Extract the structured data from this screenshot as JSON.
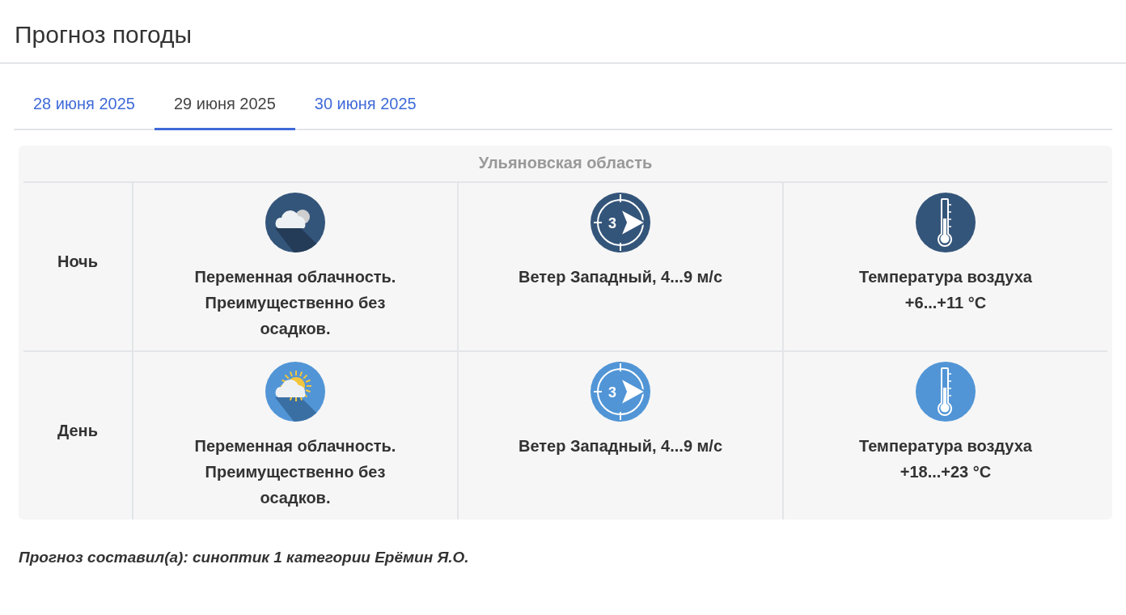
{
  "title": "Прогноз погоды",
  "tabs": [
    {
      "label": "28 июня 2025",
      "selected": false
    },
    {
      "label": "29 июня 2025",
      "selected": true
    },
    {
      "label": "30 июня 2025",
      "selected": false
    }
  ],
  "region": "Ульяновская область",
  "rows": [
    {
      "kind": "night",
      "period": "Ночь",
      "sky": "Переменная облачность. Преимущественно без осадков.",
      "wind_icon_label": "3",
      "wind": "Ветер Западный, 4...9 м/с",
      "temperature_label": "Температура воздуха",
      "temperature": "+6...+11 °С"
    },
    {
      "kind": "day",
      "period": "День",
      "sky": "Переменная облачность. Преимущественно без осадков.",
      "wind_icon_label": "3",
      "wind": "Ветер Западный, 4...9 м/с",
      "temperature_label": "Температура воздуха",
      "temperature": "+18...+23 °С"
    }
  ],
  "footer": "Прогноз составил(а): синоптик 1 категории Ерёмин Я.О."
}
